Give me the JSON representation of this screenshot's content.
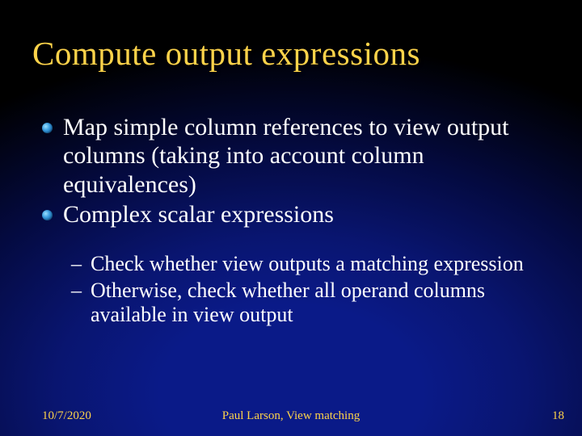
{
  "title": "Compute output expressions",
  "bullets": [
    {
      "text": "Map simple column references to view output columns (taking into account column equivalences)"
    },
    {
      "text": "Complex scalar expressions"
    }
  ],
  "subbullets": [
    {
      "text": "Check whether view outputs a matching expression"
    },
    {
      "text": "Otherwise, check whether all operand columns available in view output"
    }
  ],
  "footer": {
    "date": "10/7/2020",
    "author": "Paul Larson, View matching",
    "page": "18"
  }
}
